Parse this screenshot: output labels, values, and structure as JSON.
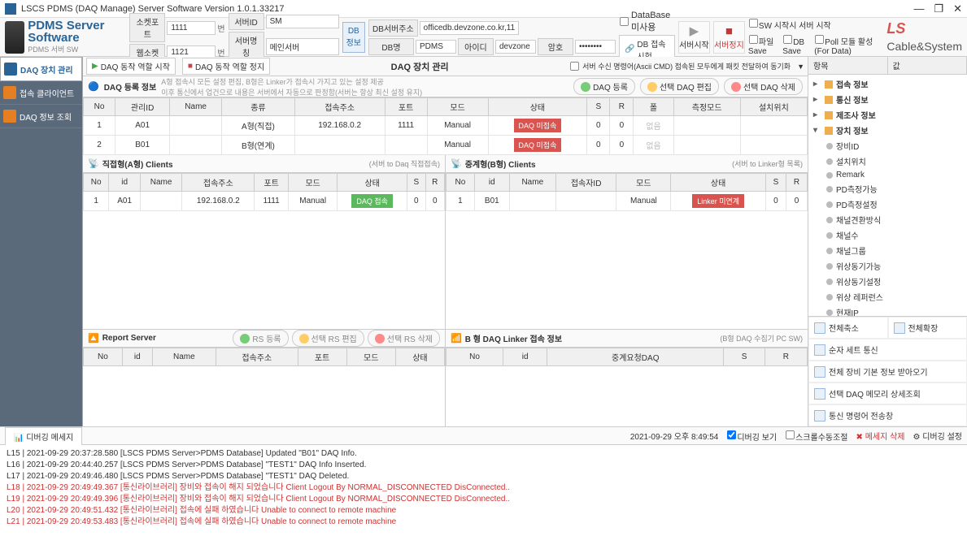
{
  "window": {
    "title": "LSCS PDMS (DAQ Manage) Server Software Version 1.0.1.33217"
  },
  "serverLabel": {
    "main": "PDMS Server Software",
    "sub": "PDMS 서버 SW"
  },
  "fields": {
    "socketPort": {
      "label": "소켓포트",
      "value": "1111",
      "suffix": "번"
    },
    "webSocket": {
      "label": "웹소켓",
      "value": "1121",
      "suffix": "번"
    },
    "serverId": {
      "label": "서버ID",
      "value": "SM"
    },
    "serverName": {
      "label": "서버명칭",
      "value": "메인서버"
    },
    "dbInfoBtn": "DB\n정보",
    "dbServerAddr": {
      "label": "DB서버주소",
      "value": "officedb.devzone.co.kr,11"
    },
    "dbName": {
      "label": "DB명",
      "value": "PDMS"
    },
    "loginId": {
      "label": "아이디",
      "value": "devzone"
    },
    "password": {
      "label": "암호",
      "value": "••••••••"
    },
    "dbUnused": "DataBase 미사용",
    "dbTestBtn": "DB 접속시험",
    "startBtn": "서버시작",
    "stopBtn": "서버정지",
    "swStartCheck": "SW 시작시 서버 시작",
    "fileSave": "파일 Save",
    "dbSave": "DB Save",
    "pollActive": "Poll 모듈 활성 (For Data)"
  },
  "brand": {
    "ls": "LS",
    "cs": " Cable&System"
  },
  "sidebar": [
    {
      "label": "DAQ 장치 관리",
      "active": true
    },
    {
      "label": "접속 클라이언트",
      "active": false
    },
    {
      "label": "DAQ 정보 조회",
      "active": false
    }
  ],
  "centerToolbar": {
    "start": "DAQ 동작 역할 시작",
    "stop": "DAQ 동작 역할 정지",
    "title": "DAQ 장치 관리",
    "ascii": "서버 수신 명령어(Ascii CMD) 접속된 모두에게 패킷 전달하여 동기화",
    "asciiCheck": false
  },
  "daqReg": {
    "title": "DAQ 등록 정보",
    "hint": "A형 접속시 모든 설정 편집, B형은 Linker가 접속시 가지고 있는 설정 제공\n이후 통신에서 업건으로 내용은 서버에서 자동으로 판정함(서버는 항상 최신 설정 유지)",
    "btnAdd": "DAQ 등록",
    "btnEdit": "선택 DAQ 편집",
    "btnDel": "선택 DAQ 삭제",
    "columns": [
      "No",
      "관리ID",
      "Name",
      "종류",
      "접속주소",
      "포트",
      "모드",
      "상태",
      "S",
      "R",
      "폴",
      "측정모드",
      "설치위치"
    ],
    "rows": [
      {
        "no": "1",
        "id": "A01",
        "name": "",
        "type": "A형(직접)",
        "addr": "192.168.0.2",
        "port": "1111",
        "mode": "Manual",
        "status": "DAQ 미접속",
        "s": "0",
        "r": "0",
        "poll": "없음",
        "mmode": "",
        "loc": ""
      },
      {
        "no": "2",
        "id": "B01",
        "name": "",
        "type": "B형(연계)",
        "addr": "",
        "port": "",
        "mode": "Manual",
        "status": "DAQ 미접속",
        "s": "0",
        "r": "0",
        "poll": "없음",
        "mmode": "",
        "loc": ""
      }
    ]
  },
  "clientsA": {
    "title": "직접형(A형) Clients",
    "note": "(서버 to Daq 직접접속)",
    "columns": [
      "No",
      "id",
      "Name",
      "접속주소",
      "포트",
      "모드",
      "상태",
      "S",
      "R"
    ],
    "rows": [
      {
        "no": "1",
        "id": "A01",
        "name": "",
        "addr": "192.168.0.2",
        "port": "1111",
        "mode": "Manual",
        "status": "DAQ 접속",
        "s": "0",
        "r": "0"
      }
    ]
  },
  "clientsB": {
    "title": "중계형(B형) Clients",
    "note": "(서버 to Linker형 목록)",
    "columns": [
      "No",
      "id",
      "Name",
      "접속자ID",
      "모드",
      "상태",
      "S",
      "R"
    ],
    "rows": [
      {
        "no": "1",
        "id": "B01",
        "name": "",
        "connId": "",
        "mode": "Manual",
        "status": "Linker 미연계",
        "s": "0",
        "r": "0"
      }
    ]
  },
  "reportServer": {
    "title": "Report Server",
    "btnAdd": "RS 등록",
    "btnEdit": "선택 RS 편집",
    "btnDel": "선택 RS 삭제",
    "columns": [
      "No",
      "id",
      "Name",
      "접속주소",
      "포트",
      "모드",
      "상태"
    ]
  },
  "daqLinker": {
    "title": "B 형 DAQ Linker 접속 정보",
    "note": "(B형 DAQ 수집기 PC SW)",
    "columns": [
      "No",
      "id",
      "중계요청DAQ",
      "S",
      "R"
    ]
  },
  "props": {
    "hKey": "항목",
    "hVal": "값",
    "cats": [
      {
        "label": "접속 정보",
        "expanded": false,
        "children": []
      },
      {
        "label": "통신 정보",
        "expanded": false,
        "children": []
      },
      {
        "label": "제조사 정보",
        "expanded": false,
        "children": []
      },
      {
        "label": "장치 정보",
        "expanded": true,
        "children": [
          "장비ID",
          "설치위치",
          "Remark",
          "PD측정가능",
          "PD측정설정",
          "채널견환방식",
          "채널수",
          "채널그룹",
          "위상동기가능",
          "위상동기설정",
          "위상 레퍼런스",
          "현재IP"
        ]
      }
    ],
    "actions": {
      "collapse": "전체축소",
      "expand": "전체확장",
      "seqSet": "순자 세트 통신",
      "allBase": "전체 장비 기본 정보 받아오기",
      "selMem": "선택 DAQ 메모리 상세조회",
      "cmdSend": "통신 명령어 전송창"
    }
  },
  "debug": {
    "tab": "디버깅 메세지",
    "timestamp": "2021-09-29 오후 8:49:54",
    "viewCheck": "디버깅 보기",
    "manualScroll": "스크롤수동조절",
    "btnDel": "메세지 삭제",
    "btnSet": "디버깅 설정",
    "lines": [
      {
        "err": false,
        "text": "L15 |  2021-09-29 20:37:28.580 [LSCS PDMS Server>PDMS Database]  Updated \"B01\" DAQ Info."
      },
      {
        "err": false,
        "text": "L16 |  2021-09-29 20:44:40.257 [LSCS PDMS Server>PDMS Database]  \"TEST1\" DAQ Info Inserted."
      },
      {
        "err": false,
        "text": "L17 |  2021-09-29 20:49:46.480 [LSCS PDMS Server>PDMS Database]  \"TEST1\" DAQ Deleted."
      },
      {
        "err": true,
        "text": "L18 |  2021-09-29 20:49:49.367 [통신라이브러리] 장비와 접속이 해지 되었습니다 Client Logout By NORMAL_DISCONNECTED DisConnected.."
      },
      {
        "err": true,
        "text": "L19 |  2021-09-29 20:49:49.396 [통신라이브러리] 장비와 접속이 해지 되었습니다 Client Logout By NORMAL_DISCONNECTED DisConnected.."
      },
      {
        "err": true,
        "text": "L20 |  2021-09-29 20:49:51.432 [통신라이브러리] 접속에 실패 하였습니다 Unable to connect to remote machine"
      },
      {
        "err": true,
        "text": "L21 |  2021-09-29 20:49:53.483 [통신라이브러리] 접속에 실패 하였습니다 Unable to connect to remote machine"
      }
    ]
  }
}
